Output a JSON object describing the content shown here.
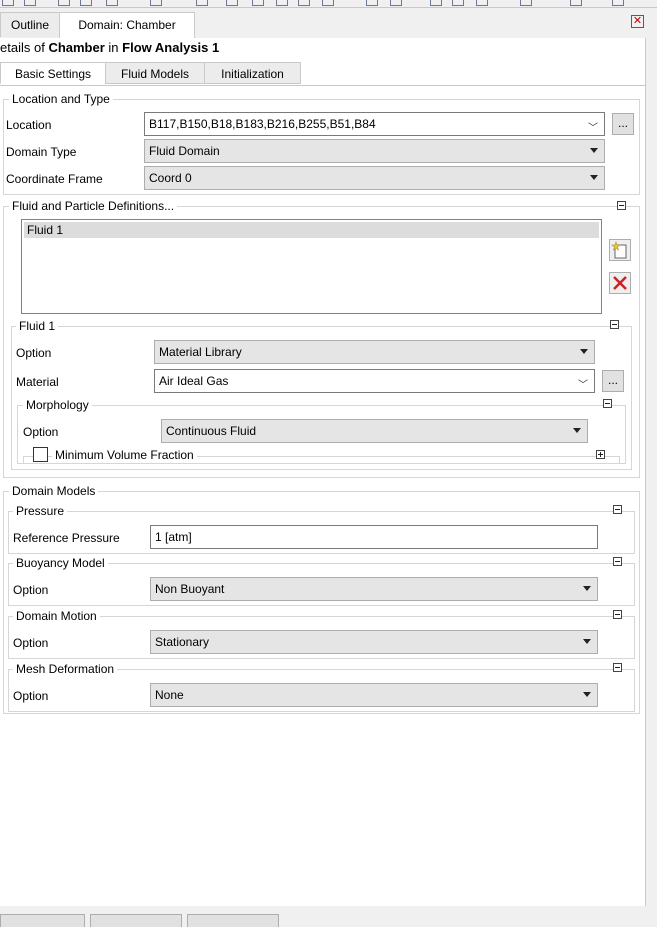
{
  "tabs": {
    "outline": "Outline",
    "domain": "Domain: Chamber"
  },
  "title": {
    "prefix": "etails of",
    "object": "Chamber",
    "in": "in",
    "context": "Flow Analysis 1"
  },
  "subtabs": [
    "Basic Settings",
    "Fluid Models",
    "Initialization"
  ],
  "location_and_type": {
    "legend": "Location and Type",
    "location_label": "Location",
    "location_value": "B117,B150,B18,B183,B216,B255,B51,B84",
    "ellipsis": "...",
    "domain_type_label": "Domain Type",
    "domain_type_value": "Fluid Domain",
    "coord_label": "Coordinate Frame",
    "coord_value": "Coord 0"
  },
  "fluid_defs": {
    "legend": "Fluid and Particle Definitions...",
    "items": [
      "Fluid 1"
    ]
  },
  "fluid1": {
    "legend": "Fluid 1",
    "option_label": "Option",
    "option_value": "Material Library",
    "material_label": "Material",
    "material_value": "Air Ideal Gas",
    "ellipsis": "...",
    "morphology": {
      "legend": "Morphology",
      "option_label": "Option",
      "option_value": "Continuous Fluid",
      "min_vol_label": "Minimum Volume Fraction"
    }
  },
  "domain_models": {
    "legend": "Domain Models",
    "pressure": {
      "legend": "Pressure",
      "label": "Reference Pressure",
      "value": "1 [atm]"
    },
    "buoyancy": {
      "legend": "Buoyancy Model",
      "label": "Option",
      "value": "Non Buoyant"
    },
    "motion": {
      "legend": "Domain Motion",
      "label": "Option",
      "value": "Stationary"
    },
    "mesh": {
      "legend": "Mesh Deformation",
      "label": "Option",
      "value": "None"
    }
  },
  "colors": {
    "delete_icon": "#cc2222",
    "new_icon": "#e8c840"
  }
}
